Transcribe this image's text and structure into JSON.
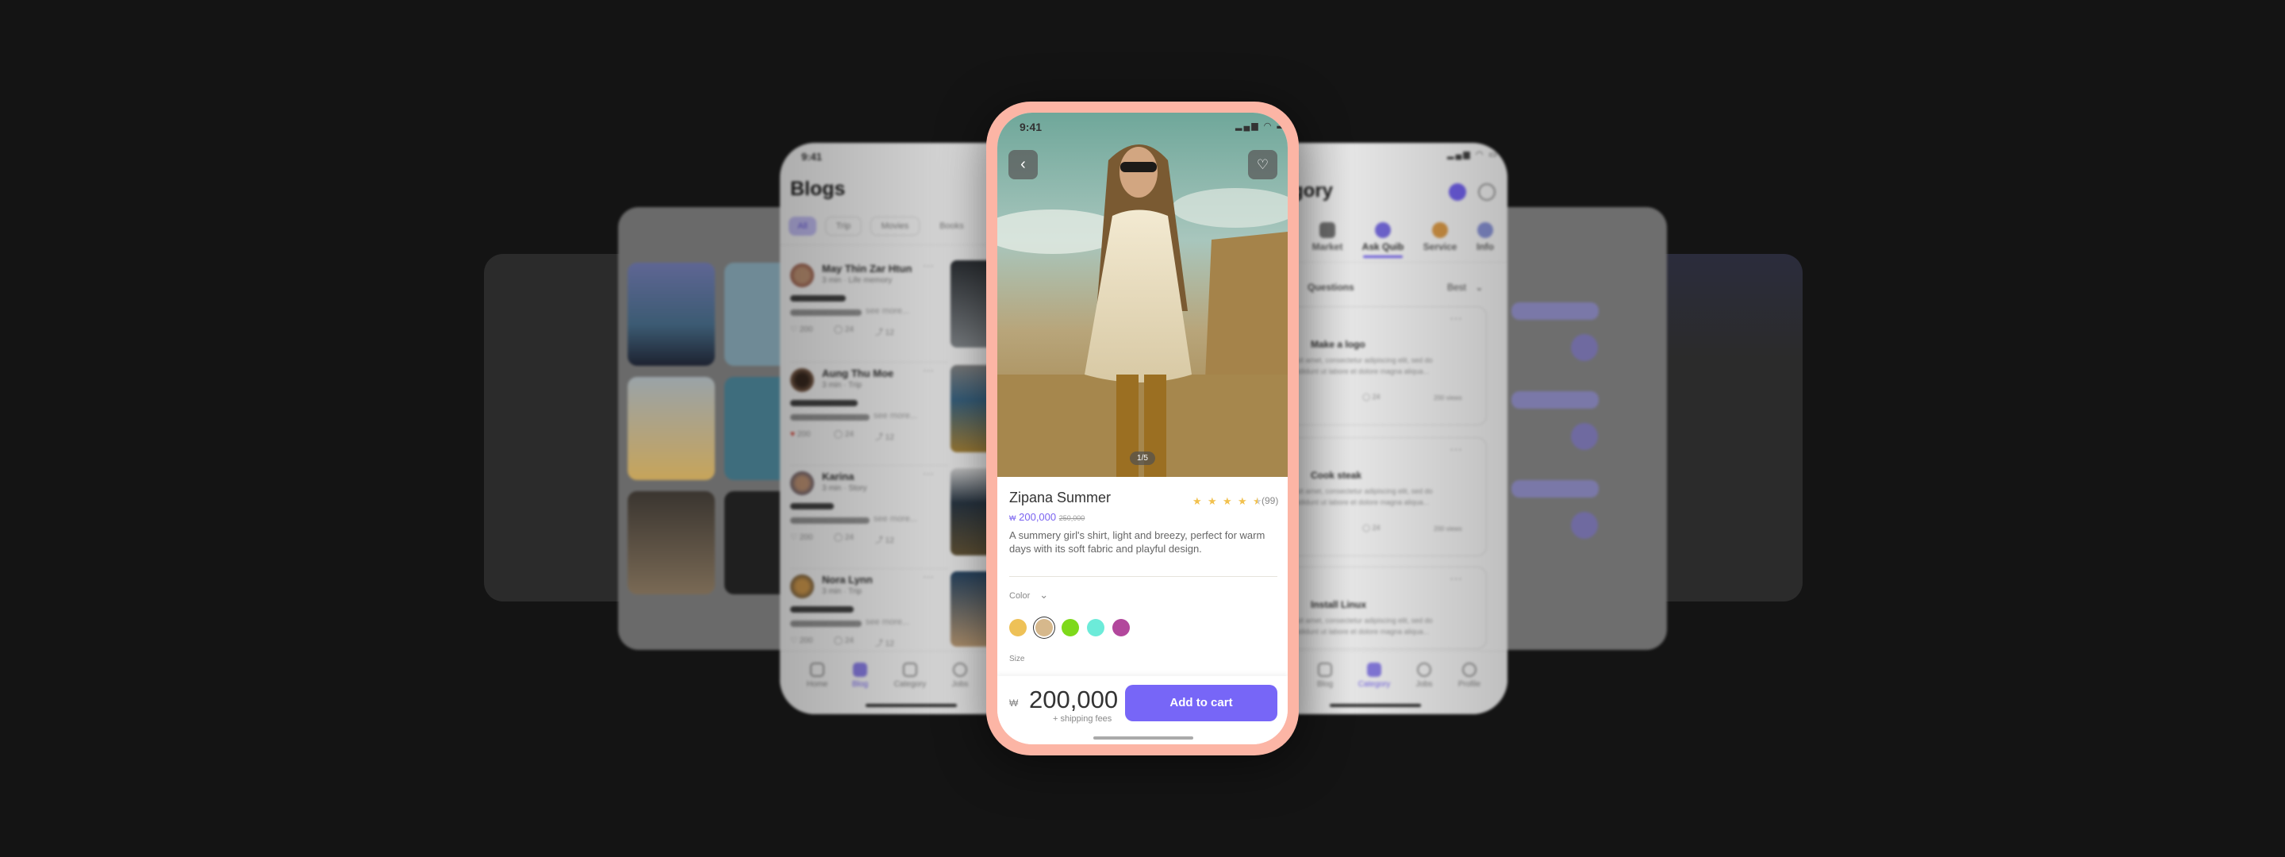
{
  "colors": {
    "background": "#141414",
    "frame": "#fcb5a5",
    "accent": "#7766f7",
    "price": "#7a63f0",
    "star": "#f2c14e"
  },
  "blogs_screen": {
    "time": "9:41",
    "title": "Blogs",
    "chips": [
      "All",
      "Trip",
      "Movies",
      "Books"
    ],
    "posts": [
      {
        "author": "May Thin Zar Htun",
        "meta": "3 min · Life memory",
        "see_more": "see more...",
        "likes": "200",
        "comments": "24",
        "shares": "12",
        "liked": false
      },
      {
        "author": "Aung Thu Moe",
        "meta": "3 min · Trip",
        "see_more": "see more...",
        "likes": "200",
        "comments": "24",
        "shares": "12",
        "liked": true
      },
      {
        "author": "Karina",
        "meta": "3 min · Story",
        "see_more": "see more...",
        "likes": "200",
        "comments": "24",
        "shares": "12",
        "liked": false
      },
      {
        "author": "Nora Lynn",
        "meta": "3 min · Trip",
        "see_more": "see more...",
        "likes": "200",
        "comments": "24",
        "shares": "12",
        "liked": false
      }
    ],
    "nav": [
      "Home",
      "Blog",
      "Category",
      "Jobs"
    ],
    "active_nav": "Blog"
  },
  "product_screen": {
    "time": "9:41",
    "image_counter": "1/5",
    "name": "Zipana Summer",
    "rating": 4.5,
    "review_count": "(99)",
    "currency": "₩",
    "price": "200,000",
    "old_price": "250,000",
    "description": "A summery girl's shirt, light and breezy, perfect for warm days with its soft fabric and playful design.",
    "color_label": "Color",
    "swatches": [
      "#eec157",
      "#d6b88c",
      "#7ed91b",
      "#6cebd9",
      "#b2479c"
    ],
    "selected_swatch": 1,
    "size_label": "Size",
    "footer": {
      "currency": "₩",
      "price": "200,000",
      "shipping": "+ shipping fees",
      "cta": "Add to cart"
    }
  },
  "category_screen": {
    "title": "Category",
    "tabs": [
      "Market",
      "Ask Quib",
      "Service",
      "Info"
    ],
    "active_tab": "Ask Quib",
    "questions_label": "Questions",
    "sort": "Best",
    "cards": [
      {
        "title": "Make a logo",
        "body1": "Lorem ipsum dolor sit amet, consectetur adipiscing elit, sed do",
        "body2": "eiusmod tempor incididunt ut labore et dolore magna aliqua...",
        "comments": "24",
        "views": "200 views"
      },
      {
        "title": "Cook steak",
        "body1": "Lorem ipsum dolor sit amet, consectetur adipiscing elit, sed do",
        "body2": "eiusmod tempor incididunt ut labore et dolore magna aliqua...",
        "comments": "24",
        "views": "200 views"
      },
      {
        "title": "Install Linux",
        "body1": "Lorem ipsum dolor sit amet, consectetur adipiscing elit, sed do",
        "body2": "eiusmod tempor incididunt ut labore et dolore magna aliqua..."
      }
    ],
    "nav": [
      "Blog",
      "Category",
      "Jobs",
      "Profile"
    ],
    "active_nav": "Category"
  }
}
